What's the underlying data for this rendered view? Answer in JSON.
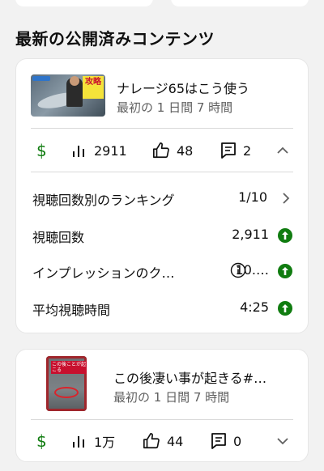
{
  "section": {
    "title": "最新の公開済みコンテンツ"
  },
  "colors": {
    "accent_green": "#107c10",
    "text": "#0f0f0f",
    "subtext": "#606060"
  },
  "videos": [
    {
      "title": "ナレージ65はこう使う",
      "subtitle": "最初の 1 日間 7 時間",
      "thumbnail_badge": "攻略",
      "stats": {
        "views": "2911",
        "likes": "48",
        "comments": "2"
      },
      "expanded": true,
      "metrics": [
        {
          "label": "視聴回数別のランキング",
          "value": "1/10",
          "icon": "chevron-right-icon"
        },
        {
          "label": "視聴回数",
          "value": "2,911",
          "icon": "arrow-up-circle-icon"
        },
        {
          "label": "インプレッションのク…",
          "value": "10.…",
          "icon": "arrow-up-circle-icon",
          "info_icon": "info-icon"
        },
        {
          "label": "平均視聴時間",
          "value": "4:25",
          "icon": "arrow-up-circle-icon"
        }
      ]
    },
    {
      "title": "この後凄い事が起きる#…",
      "subtitle": "最初の 1 日間 7 時間",
      "thumbnail_badge": "この後ことが起こる",
      "stats": {
        "views": "1万",
        "likes": "44",
        "comments": "0"
      },
      "expanded": false
    }
  ]
}
